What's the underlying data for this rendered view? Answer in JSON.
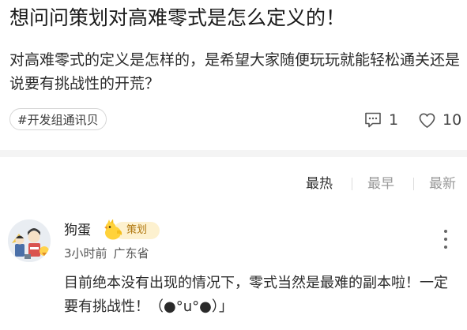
{
  "post": {
    "title": "想问问策划对高难零式是怎么定义的！",
    "body": "对高难零式的定义是怎样的，是希望大家随便玩玩就能轻松通关还是说要有挑战性的开荒？",
    "tag": "#开发组通讯贝",
    "comment_count": "1",
    "like_count": "10"
  },
  "sort_tabs": {
    "hot": "最热",
    "early": "最早",
    "latest": "最新"
  },
  "comment": {
    "username": "狗蛋",
    "badge": "策划",
    "time": "3小时前",
    "location": "广东省",
    "text": "目前绝本没有出现的情况下，零式当然是最难的副本啦！一定要有挑战性！（●°u°●）」"
  },
  "icons": {
    "comments": "comment-icon",
    "likes": "heart-icon",
    "more": "more-vertical-icon",
    "badge": "chocobo-icon"
  }
}
